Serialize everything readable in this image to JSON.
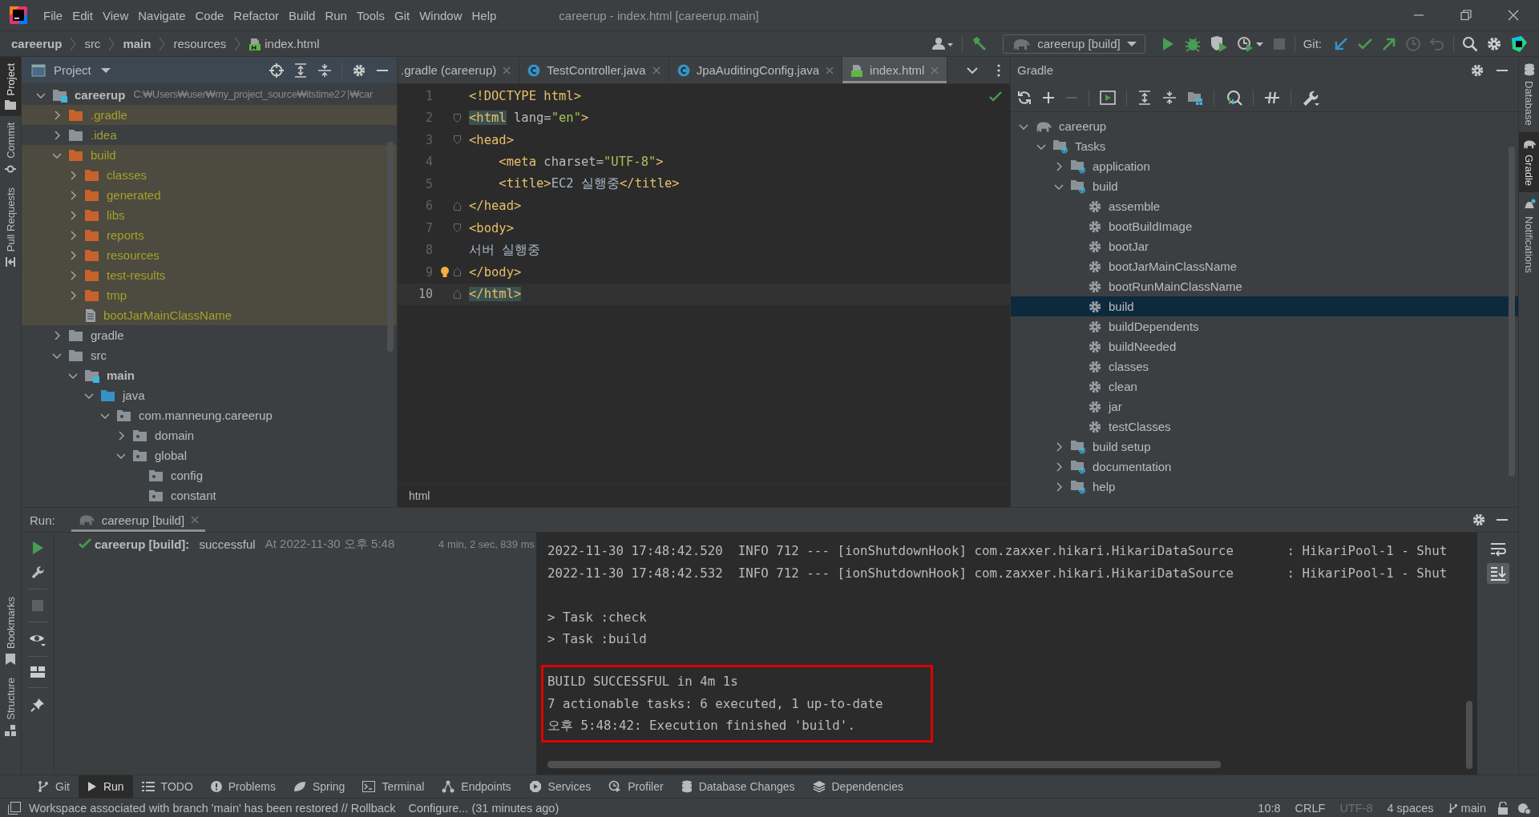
{
  "window": {
    "title": "careerup - index.html [careerup.main]"
  },
  "menu": [
    "File",
    "Edit",
    "View",
    "Navigate",
    "Code",
    "Refactor",
    "Build",
    "Run",
    "Tools",
    "Git",
    "Window",
    "Help"
  ],
  "breadcrumbs": [
    {
      "text": "careerup",
      "kind": "module"
    },
    {
      "text": "src",
      "kind": "folder"
    },
    {
      "text": "main",
      "kind": "module"
    },
    {
      "text": "resources",
      "kind": "folder"
    },
    {
      "text": "index.html",
      "kind": "file"
    }
  ],
  "toolbar": {
    "run_configuration": "careerup [build]",
    "git_label": "Git:"
  },
  "left_tool_windows": [
    {
      "label": "Project",
      "selected": true
    },
    {
      "label": "Commit",
      "selected": false
    },
    {
      "label": "Pull Requests",
      "selected": false
    }
  ],
  "left_bottom_tool_windows": [
    {
      "label": "Bookmarks",
      "selected": false
    },
    {
      "label": "Structure",
      "selected": false
    }
  ],
  "right_tool_windows": [
    {
      "label": "Database",
      "selected": false
    },
    {
      "label": "Gradle",
      "selected": true
    },
    {
      "label": "Notifications",
      "selected": false
    }
  ],
  "project_panel": {
    "title": "Project",
    "tree": [
      {
        "name": "careerup",
        "kind": "module",
        "excluded": false,
        "ignored": false,
        "path": "C:₩Users₩user₩my_project_source₩itstime2기₩car",
        "expanded": true,
        "children": [
          {
            "name": ".gradle",
            "kind": "folder",
            "excluded": true,
            "ignored": true,
            "expanded": false
          },
          {
            "name": ".idea",
            "kind": "folder",
            "excluded": false,
            "ignored": true,
            "expanded": false
          },
          {
            "name": "build",
            "kind": "folder",
            "excluded": true,
            "ignored": true,
            "expanded": true,
            "children": [
              {
                "name": "classes",
                "kind": "folder",
                "excluded": true,
                "ignored": true,
                "expanded": false
              },
              {
                "name": "generated",
                "kind": "folder",
                "excluded": true,
                "ignored": true,
                "expanded": false
              },
              {
                "name": "libs",
                "kind": "folder",
                "excluded": true,
                "ignored": true,
                "expanded": false
              },
              {
                "name": "reports",
                "kind": "folder",
                "excluded": true,
                "ignored": true,
                "expanded": false
              },
              {
                "name": "resources",
                "kind": "folder",
                "excluded": true,
                "ignored": true,
                "expanded": false
              },
              {
                "name": "test-results",
                "kind": "folder",
                "excluded": true,
                "ignored": true,
                "expanded": false
              },
              {
                "name": "tmp",
                "kind": "folder",
                "excluded": true,
                "ignored": true,
                "expanded": false
              },
              {
                "name": "bootJarMainClassName",
                "kind": "file",
                "excluded": true,
                "ignored": true
              }
            ]
          },
          {
            "name": "gradle",
            "kind": "folder",
            "excluded": false,
            "ignored": false,
            "expanded": false
          },
          {
            "name": "src",
            "kind": "folder",
            "excluded": false,
            "ignored": false,
            "expanded": true,
            "children": [
              {
                "name": "main",
                "kind": "module",
                "excluded": false,
                "ignored": false,
                "expanded": true,
                "children": [
                  {
                    "name": "java",
                    "kind": "source",
                    "excluded": false,
                    "ignored": false,
                    "expanded": true,
                    "children": [
                      {
                        "name": "com.manneung.careerup",
                        "kind": "package",
                        "excluded": false,
                        "ignored": false,
                        "expanded": true,
                        "children": [
                          {
                            "name": "domain",
                            "kind": "package",
                            "excluded": false,
                            "ignored": false,
                            "expanded": false
                          },
                          {
                            "name": "global",
                            "kind": "package",
                            "excluded": false,
                            "ignored": false,
                            "expanded": true,
                            "children": [
                              {
                                "name": "config",
                                "kind": "package",
                                "excluded": false,
                                "ignored": false
                              },
                              {
                                "name": "constant",
                                "kind": "package",
                                "excluded": false,
                                "ignored": false
                              }
                            ]
                          }
                        ]
                      }
                    ]
                  }
                ]
              }
            ]
          }
        ]
      }
    ]
  },
  "editor": {
    "tabs": [
      {
        "label": ".gradle (careerup)",
        "kind": "gradle",
        "selected": false
      },
      {
        "label": "TestController.java",
        "kind": "java",
        "selected": false
      },
      {
        "label": "JpaAuditingConfig.java",
        "kind": "java",
        "selected": false
      },
      {
        "label": "index.html",
        "kind": "html",
        "selected": true
      }
    ],
    "lines": [
      {
        "number": "1",
        "current": false,
        "fold_open": false,
        "fold_close": false,
        "tokens": [
          {
            "t": "<!DOCTYPE html>",
            "kind": "tag"
          }
        ]
      },
      {
        "number": "2",
        "current": false,
        "fold_open": true,
        "fold_close": false,
        "tokens": [
          {
            "t": "<html",
            "kind": "match"
          },
          {
            "t": " lang=",
            "kind": "attr"
          },
          {
            "t": "\"en\"",
            "kind": "value"
          },
          {
            "t": ">",
            "kind": "tag"
          }
        ]
      },
      {
        "number": "3",
        "current": false,
        "fold_open": true,
        "fold_close": false,
        "tokens": [
          {
            "t": "<head>",
            "kind": "tag"
          }
        ]
      },
      {
        "number": "4",
        "current": false,
        "fold_open": false,
        "fold_close": false,
        "tokens": [
          {
            "t": "    <meta",
            "kind": "tag"
          },
          {
            "t": " charset=",
            "kind": "attr"
          },
          {
            "t": "\"UTF-8\"",
            "kind": "value"
          },
          {
            "t": ">",
            "kind": "tag"
          }
        ]
      },
      {
        "number": "5",
        "current": false,
        "fold_open": false,
        "fold_close": false,
        "tokens": [
          {
            "t": "    <title>",
            "kind": "tag"
          },
          {
            "t": "EC2 실행중",
            "kind": "text"
          },
          {
            "t": "</title>",
            "kind": "tag"
          }
        ]
      },
      {
        "number": "6",
        "current": false,
        "fold_open": false,
        "fold_close": true,
        "tokens": [
          {
            "t": "</head>",
            "kind": "tag"
          }
        ]
      },
      {
        "number": "7",
        "current": false,
        "fold_open": true,
        "fold_close": false,
        "tokens": [
          {
            "t": "<body>",
            "kind": "tag"
          }
        ]
      },
      {
        "number": "8",
        "current": false,
        "fold_open": false,
        "fold_close": false,
        "tokens": [
          {
            "t": "서버 실행중",
            "kind": "text"
          }
        ]
      },
      {
        "number": "9",
        "current": false,
        "fold_open": false,
        "fold_close": true,
        "tokens": [
          {
            "t": "</body>",
            "kind": "tag"
          }
        ]
      },
      {
        "number": "10",
        "current": true,
        "fold_open": false,
        "fold_close": true,
        "tokens": [
          {
            "t": "</html>",
            "kind": "match"
          }
        ]
      }
    ],
    "breadcrumb": "html"
  },
  "gradle_panel": {
    "title": "Gradle",
    "tree": [
      {
        "name": "careerup",
        "kind": "project",
        "expanded": true,
        "children": [
          {
            "name": "Tasks",
            "kind": "group",
            "expanded": true,
            "children": [
              {
                "name": "application",
                "kind": "group",
                "expanded": false
              },
              {
                "name": "build",
                "kind": "group",
                "expanded": true,
                "children": [
                  {
                    "name": "assemble",
                    "kind": "task",
                    "selected": false
                  },
                  {
                    "name": "bootBuildImage",
                    "kind": "task",
                    "selected": false
                  },
                  {
                    "name": "bootJar",
                    "kind": "task",
                    "selected": false
                  },
                  {
                    "name": "bootJarMainClassName",
                    "kind": "task",
                    "selected": false
                  },
                  {
                    "name": "bootRunMainClassName",
                    "kind": "task",
                    "selected": false
                  },
                  {
                    "name": "build",
                    "kind": "task",
                    "selected": true
                  },
                  {
                    "name": "buildDependents",
                    "kind": "task",
                    "selected": false
                  },
                  {
                    "name": "buildNeeded",
                    "kind": "task",
                    "selected": false
                  },
                  {
                    "name": "classes",
                    "kind": "task",
                    "selected": false
                  },
                  {
                    "name": "clean",
                    "kind": "task",
                    "selected": false
                  },
                  {
                    "name": "jar",
                    "kind": "task",
                    "selected": false
                  },
                  {
                    "name": "testClasses",
                    "kind": "task",
                    "selected": false
                  }
                ]
              },
              {
                "name": "build setup",
                "kind": "group",
                "expanded": false
              },
              {
                "name": "documentation",
                "kind": "group",
                "expanded": false
              },
              {
                "name": "help",
                "kind": "group",
                "expanded": false
              }
            ]
          }
        ]
      }
    ]
  },
  "run_panel": {
    "label": "Run:",
    "tab": "careerup [build]",
    "result": {
      "name": "careerup [build]:",
      "status": "successful",
      "time": "At 2022-11-30 오후 5:48",
      "duration": "4 min, 2 sec, 839 ms"
    },
    "console": [
      {
        "boxed": false,
        "lines": [
          "2022-11-30 17:48:42.520  INFO 712 --- [ionShutdownHook] com.zaxxer.hikari.HikariDataSource       : HikariPool-1 - Shut",
          "2022-11-30 17:48:42.532  INFO 712 --- [ionShutdownHook] com.zaxxer.hikari.HikariDataSource       : HikariPool-1 - Shut"
        ]
      },
      {
        "boxed": false,
        "lines": [
          "> Task :check",
          "> Task :build"
        ]
      },
      {
        "boxed": true,
        "lines": [
          "BUILD SUCCESSFUL in 4m 1s",
          "7 actionable tasks: 6 executed, 1 up-to-date",
          "오후 5:48:42: Execution finished 'build'."
        ]
      }
    ]
  },
  "tool_tabs": [
    {
      "label": "Git",
      "selected": false
    },
    {
      "label": "Run",
      "selected": true
    },
    {
      "label": "TODO",
      "selected": false
    },
    {
      "label": "Problems",
      "selected": false
    },
    {
      "label": "Spring",
      "selected": false
    },
    {
      "label": "Terminal",
      "selected": false
    },
    {
      "label": "Endpoints",
      "selected": false
    },
    {
      "label": "Services",
      "selected": false
    },
    {
      "label": "Profiler",
      "selected": false
    },
    {
      "label": "Database Changes",
      "selected": false
    },
    {
      "label": "Dependencies",
      "selected": false
    }
  ],
  "status_bar": {
    "message": "Workspace associated with branch 'main' has been restored // Rollback",
    "task": "Configure... (31 minutes ago)",
    "items": [
      {
        "text": "10:8",
        "kind": "text",
        "disabled": false
      },
      {
        "text": "CRLF",
        "kind": "text",
        "disabled": false
      },
      {
        "text": "UTF-8",
        "kind": "text",
        "disabled": true
      },
      {
        "text": "4 spaces",
        "kind": "text",
        "disabled": false
      },
      {
        "text": "main",
        "kind": "branch",
        "disabled": false
      }
    ]
  }
}
